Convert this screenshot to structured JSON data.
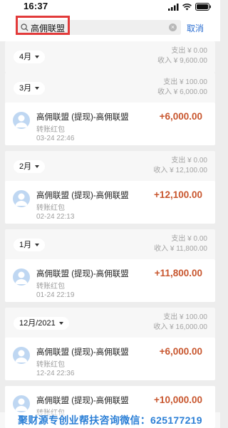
{
  "status": {
    "time": "16:37"
  },
  "search": {
    "query": "高佣联盟",
    "cancel": "取消"
  },
  "groups": [
    {
      "month": "4月",
      "expense": "支出 ¥ 0.00",
      "income": "收入 ¥ 9,600.00",
      "transactions": []
    },
    {
      "month": "3月",
      "expense": "支出 ¥ 100.00",
      "income": "收入 ¥ 6,000.00",
      "transactions": [
        {
          "title": "高佣联盟 (提现)-高佣联盟",
          "type": "转账红包",
          "time": "03-24  22:46",
          "amount": "+6,000.00"
        }
      ]
    },
    {
      "month": "2月",
      "expense": "支出 ¥ 0.00",
      "income": "收入 ¥ 12,100.00",
      "transactions": [
        {
          "title": "高佣联盟 (提现)-高佣联盟",
          "type": "转账红包",
          "time": "02-24  22:13",
          "amount": "+12,100.00"
        }
      ]
    },
    {
      "month": "1月",
      "expense": "支出 ¥ 0.00",
      "income": "收入 ¥ 11,800.00",
      "transactions": [
        {
          "title": "高佣联盟 (提现)-高佣联盟",
          "type": "转账红包",
          "time": "01-24  22:19",
          "amount": "+11,800.00"
        }
      ]
    },
    {
      "month": "12月/2021",
      "expense": "支出 ¥ 100.00",
      "income": "收入 ¥ 16,000.00",
      "transactions": [
        {
          "title": "高佣联盟 (提现)-高佣联盟",
          "type": "转账红包",
          "time": "12-24  22:36",
          "amount": "+6,000.00"
        },
        {
          "title": "高佣联盟 (提现)-高佣联盟",
          "type": "转账红包",
          "time": "",
          "amount": "+10,000.00"
        }
      ]
    }
  ],
  "watermark": "聚财源专创业帮扶咨询微信：625177219",
  "colors": {
    "amount": "#c8562e",
    "accent": "#2c6fd1",
    "highlight": "#e23a3a",
    "watermark": "#2b7fd6"
  }
}
